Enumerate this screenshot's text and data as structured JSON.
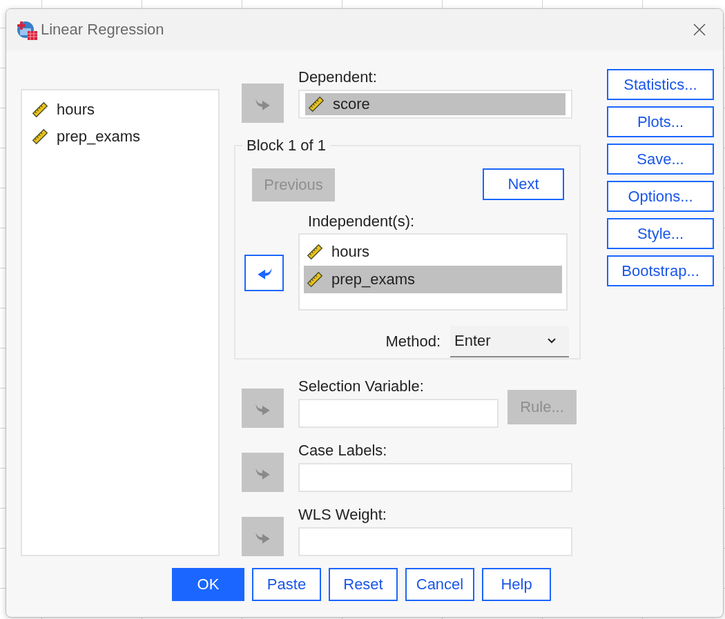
{
  "window": {
    "title": "Linear Regression"
  },
  "variables": [
    {
      "name": "hours",
      "selected": false
    },
    {
      "name": "prep_exams",
      "selected": false
    }
  ],
  "dependent": {
    "label": "Dependent:",
    "arrow": {
      "kind": "add",
      "disabled": true
    },
    "items": [
      {
        "name": "score",
        "selected": true
      }
    ]
  },
  "block": {
    "title": "Block 1 of 1",
    "previous": {
      "label": "Previous",
      "disabled": true
    },
    "next": {
      "label": "Next",
      "disabled": false
    },
    "independents": {
      "label": "Independent(s):",
      "arrow": {
        "kind": "remove",
        "disabled": false
      },
      "items": [
        {
          "name": "hours",
          "selected": false
        },
        {
          "name": "prep_exams",
          "selected": true
        }
      ]
    },
    "method": {
      "label": "Method:",
      "value": "Enter"
    }
  },
  "selection_variable": {
    "label": "Selection Variable:",
    "arrow": {
      "kind": "add",
      "disabled": true
    },
    "rule": {
      "label": "Rule...",
      "disabled": true
    }
  },
  "case_labels": {
    "label": "Case Labels:",
    "arrow": {
      "kind": "add",
      "disabled": true
    }
  },
  "wls_weight": {
    "label": "WLS Weight:",
    "arrow": {
      "kind": "add",
      "disabled": true
    }
  },
  "side_buttons": [
    {
      "label": "Statistics..."
    },
    {
      "label": "Plots..."
    },
    {
      "label": "Save..."
    },
    {
      "label": "Options..."
    },
    {
      "label": "Style..."
    },
    {
      "label": "Bootstrap..."
    }
  ],
  "buttons": [
    {
      "label": "OK",
      "default": true
    },
    {
      "label": "Paste",
      "default": false
    },
    {
      "label": "Reset",
      "default": false
    },
    {
      "label": "Cancel",
      "default": false
    },
    {
      "label": "Help",
      "default": false
    }
  ]
}
